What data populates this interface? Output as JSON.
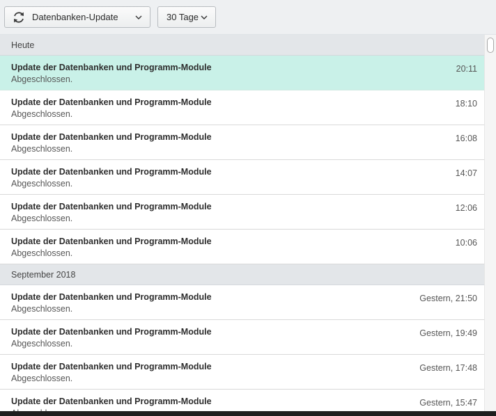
{
  "toolbar": {
    "update_dropdown": {
      "icon": "refresh-icon",
      "label": "Datenbanken-Update"
    },
    "period_dropdown": {
      "label": "30 Tage"
    }
  },
  "sections": [
    {
      "header": "Heute",
      "rows": [
        {
          "title": "Update der Datenbanken und Programm-Module",
          "status": "Abgeschlossen.",
          "time": "20:11",
          "selected": true
        },
        {
          "title": "Update der Datenbanken und Programm-Module",
          "status": "Abgeschlossen.",
          "time": "18:10"
        },
        {
          "title": "Update der Datenbanken und Programm-Module",
          "status": "Abgeschlossen.",
          "time": "16:08"
        },
        {
          "title": "Update der Datenbanken und Programm-Module",
          "status": "Abgeschlossen.",
          "time": "14:07"
        },
        {
          "title": "Update der Datenbanken und Programm-Module",
          "status": "Abgeschlossen.",
          "time": "12:06"
        },
        {
          "title": "Update der Datenbanken und Programm-Module",
          "status": "Abgeschlossen.",
          "time": "10:06"
        }
      ]
    },
    {
      "header": "September 2018",
      "rows": [
        {
          "title": "Update der Datenbanken und Programm-Module",
          "status": "Abgeschlossen.",
          "time": "Gestern, 21:50"
        },
        {
          "title": "Update der Datenbanken und Programm-Module",
          "status": "Abgeschlossen.",
          "time": "Gestern, 19:49"
        },
        {
          "title": "Update der Datenbanken und Programm-Module",
          "status": "Abgeschlossen.",
          "time": "Gestern, 17:48"
        },
        {
          "title": "Update der Datenbanken und Programm-Module",
          "status": "Abgeschlossen.",
          "time": "Gestern, 15:47"
        }
      ]
    }
  ],
  "colors": {
    "selected_row": "#c9f1e8",
    "section_header": "#e3e6e9",
    "toolbar": "#eef0f2"
  }
}
